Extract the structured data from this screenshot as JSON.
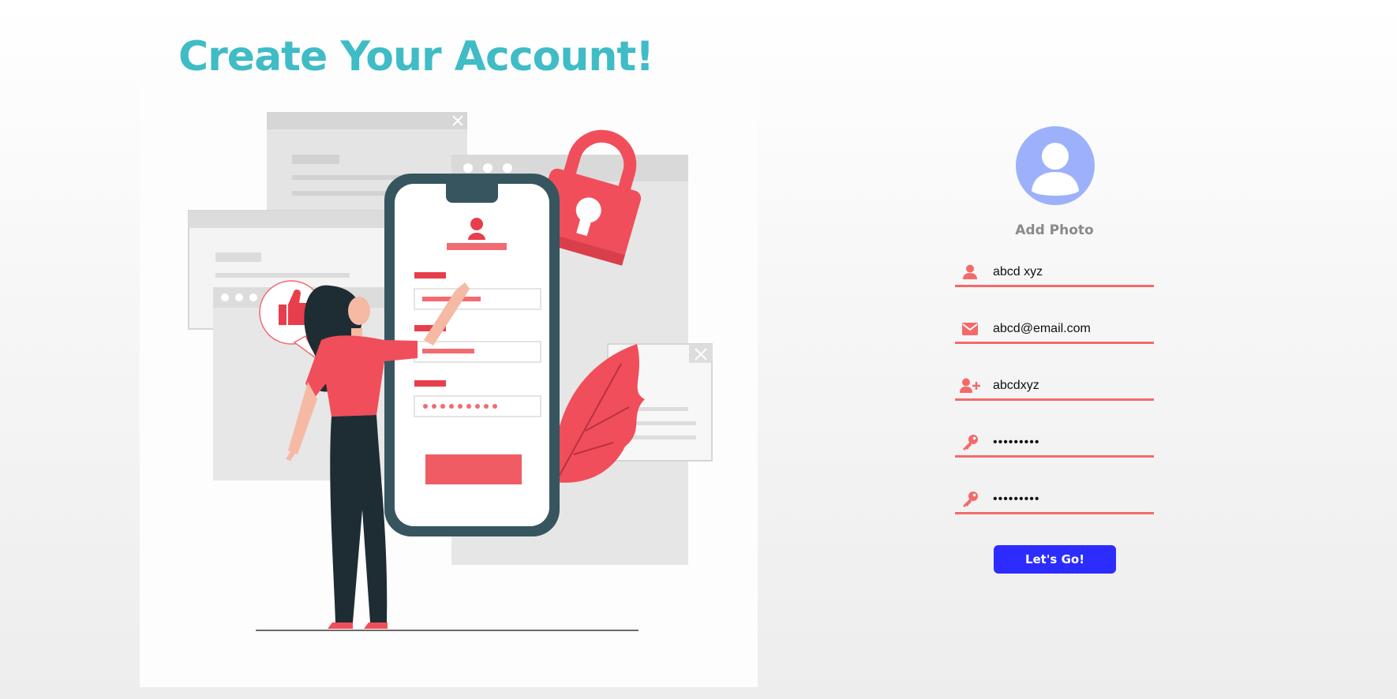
{
  "title": "Create Your Account!",
  "colors": {
    "title": "#3fbcc6",
    "accent": "#f46a6a",
    "avatar": "#9db1fb",
    "button": "#2c2cff"
  },
  "illustration": {
    "name": "signup-illustration",
    "icons": [
      "thumbs-up-icon",
      "padlock-icon",
      "phone-icon",
      "leaf-icon"
    ]
  },
  "form": {
    "avatar_icon": "user-avatar-icon",
    "add_photo_label": "Add Photo",
    "fields": [
      {
        "icon": "user-icon",
        "type": "text",
        "value": "abcd xyz"
      },
      {
        "icon": "envelope-icon",
        "type": "email",
        "value": "abcd@email.com"
      },
      {
        "icon": "user-plus-icon",
        "type": "text",
        "value": "abcdxyz"
      },
      {
        "icon": "key-icon",
        "type": "password",
        "value": "•••••••••"
      },
      {
        "icon": "key-icon",
        "type": "password",
        "value": "•••••••••"
      }
    ],
    "submit_label": "Let's Go!"
  }
}
